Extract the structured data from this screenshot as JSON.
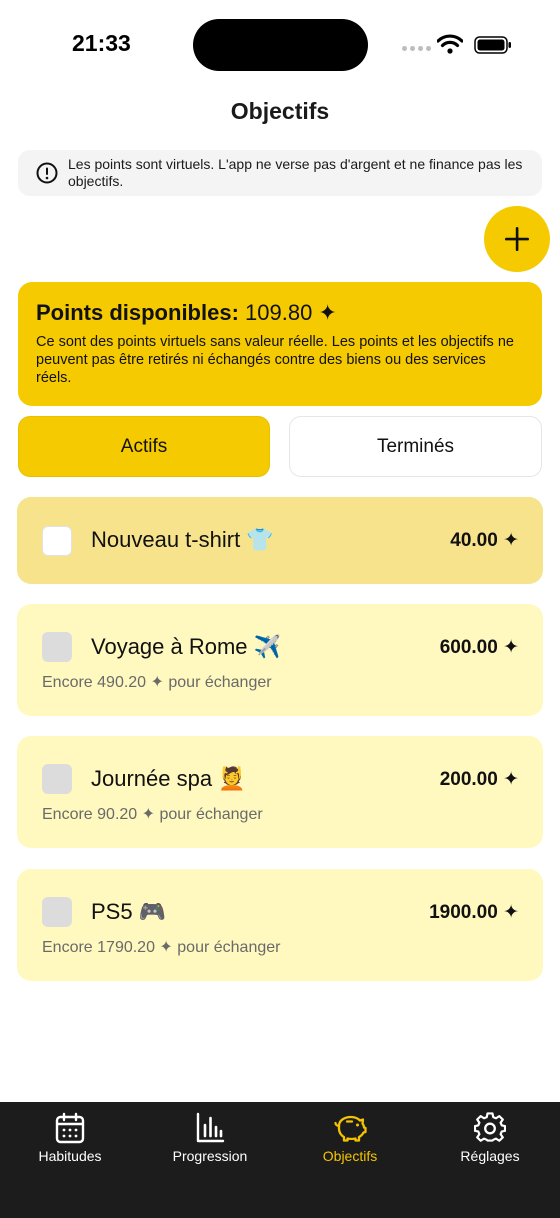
{
  "status_bar": {
    "time": "21:33"
  },
  "header": {
    "title": "Objectifs"
  },
  "info_banner": {
    "text": "Les points sont virtuels. L'app ne verse pas d'argent et ne finance pas les objectifs.",
    "icon": "alert-circle-icon"
  },
  "add_button": {
    "label": "+",
    "icon": "plus-icon"
  },
  "points_card": {
    "label": "Points disponibles:",
    "value": "109.80 ✦",
    "description": "Ce sont des points virtuels sans valeur réelle. Les points et les objectifs ne peuvent pas être retirés ni échangés contre des biens ou des services réels."
  },
  "segments": {
    "active_label": "Actifs",
    "done_label": "Terminés",
    "selected": "Actifs"
  },
  "goals": [
    {
      "name": "Nouveau t-shirt 👕",
      "amount": "40.00 ✦",
      "remaining": "",
      "selected": true
    },
    {
      "name": "Voyage à Rome ✈️",
      "amount": "600.00 ✦",
      "remaining": "Encore 490.20 ✦ pour échanger",
      "selected": false
    },
    {
      "name": "Journée spa 💆",
      "amount": "200.00 ✦",
      "remaining": "Encore 90.20 ✦ pour échanger",
      "selected": false
    },
    {
      "name": "PS5 🎮",
      "amount": "1900.00 ✦",
      "remaining": "Encore 1790.20 ✦ pour échanger",
      "selected": false
    }
  ],
  "tab_bar": {
    "items": [
      {
        "label": "Habitudes",
        "icon": "calendar-icon"
      },
      {
        "label": "Progression",
        "icon": "bar-chart-icon"
      },
      {
        "label": "Objectifs",
        "icon": "piggy-bank-icon"
      },
      {
        "label": "Réglages",
        "icon": "gear-icon"
      }
    ],
    "active": "Objectifs"
  },
  "colors": {
    "accent": "#f5ca00",
    "card_selected": "#f7e38b",
    "card": "#fff8bf",
    "tab_bar": "#1c1c1c",
    "tab_active": "#f5c400"
  }
}
